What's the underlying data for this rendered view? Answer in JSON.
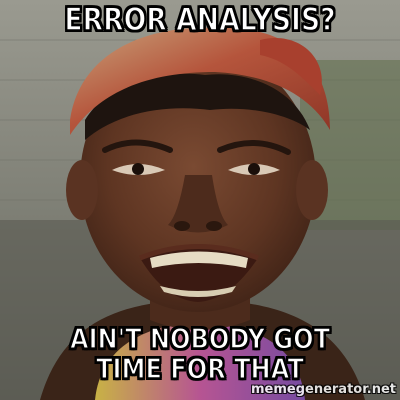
{
  "meme": {
    "top_text": "ERROR ANALYSIS?",
    "bottom_text": "AIN'T NOBODY GOT TIME FOR THAT",
    "watermark": "memegenerator.net"
  },
  "colors": {
    "caption_fill": "#ffffff",
    "caption_outline": "#000000",
    "headscarf": "#b0503a",
    "skin": "#6b3f2a",
    "background_wall": "#8a8a80"
  }
}
